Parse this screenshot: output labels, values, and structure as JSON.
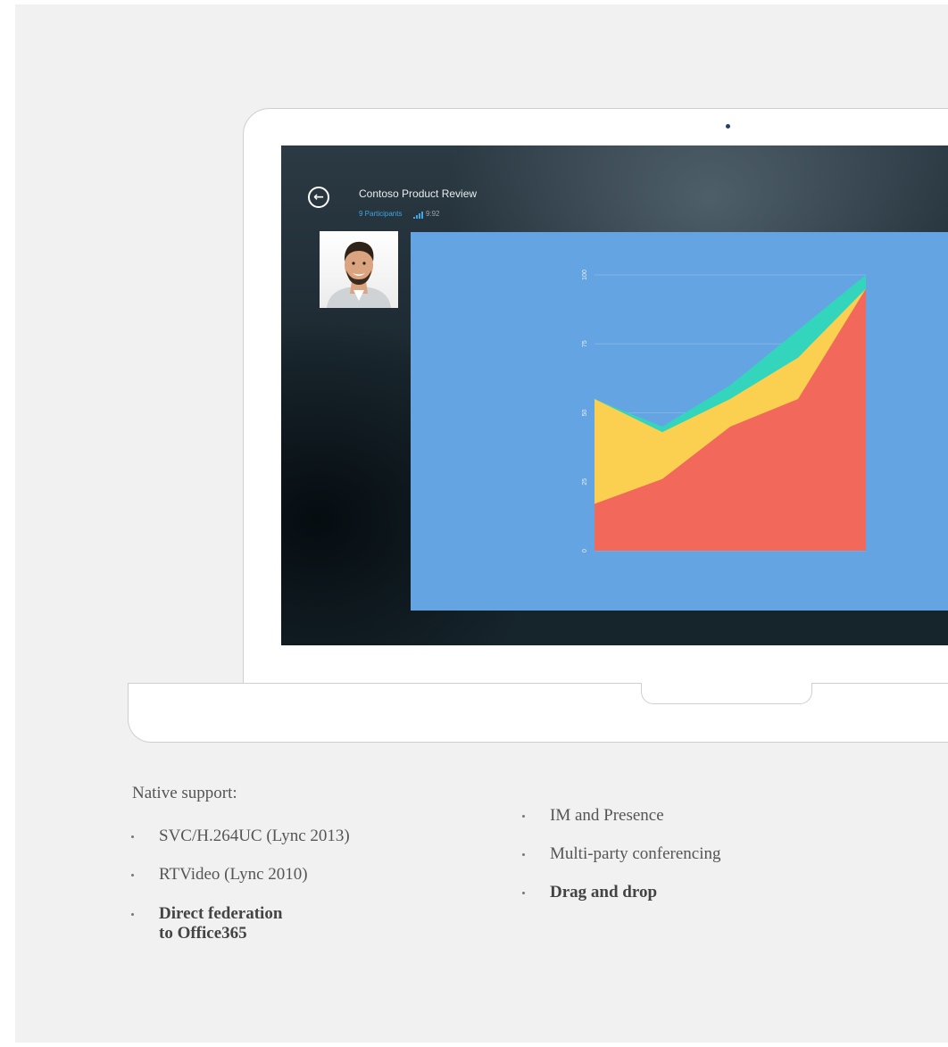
{
  "call": {
    "title": "Contoso Product Review",
    "participants": "9 Participants",
    "time": "9:92",
    "back_icon": "back-arrow-icon",
    "signal_icon": "signal-bars-icon"
  },
  "colors": {
    "page_bg": "#f1f1f1",
    "slide_bg": "#65a4e2",
    "accent_blue": "#3da6e3",
    "series_red": "#f2685a",
    "series_yellow": "#fbcf50",
    "series_teal": "#33d5bd"
  },
  "chart_data": {
    "type": "area",
    "title": "",
    "xlabel": "",
    "ylabel": "",
    "ylim": [
      0,
      100
    ],
    "y_ticks": [
      "0",
      "25",
      "50",
      "75",
      "100"
    ],
    "x": [
      0,
      1,
      2,
      3,
      4
    ],
    "stacked": false,
    "series": [
      {
        "values": [
          55,
          45,
          60,
          80,
          100
        ],
        "color": "#33d5bd"
      },
      {
        "values": [
          55,
          43,
          55,
          70,
          95
        ],
        "color": "#fbcf50"
      },
      {
        "values": [
          17,
          26,
          45,
          55,
          95
        ],
        "color": "#f2685a"
      }
    ],
    "grid": true,
    "legend": "none"
  },
  "content": {
    "intro": "Native support:",
    "left_items": [
      {
        "text": "SVC/H.264UC  (Lync 2013)"
      },
      {
        "text": "RTVideo (Lync 2010)"
      },
      {
        "line1": "Direct federation",
        "line2": "to Office365"
      }
    ],
    "right_items": [
      {
        "text": "IM and Presence"
      },
      {
        "text": "Multi-party conferencing"
      },
      {
        "text": "Drag and drop"
      }
    ]
  }
}
